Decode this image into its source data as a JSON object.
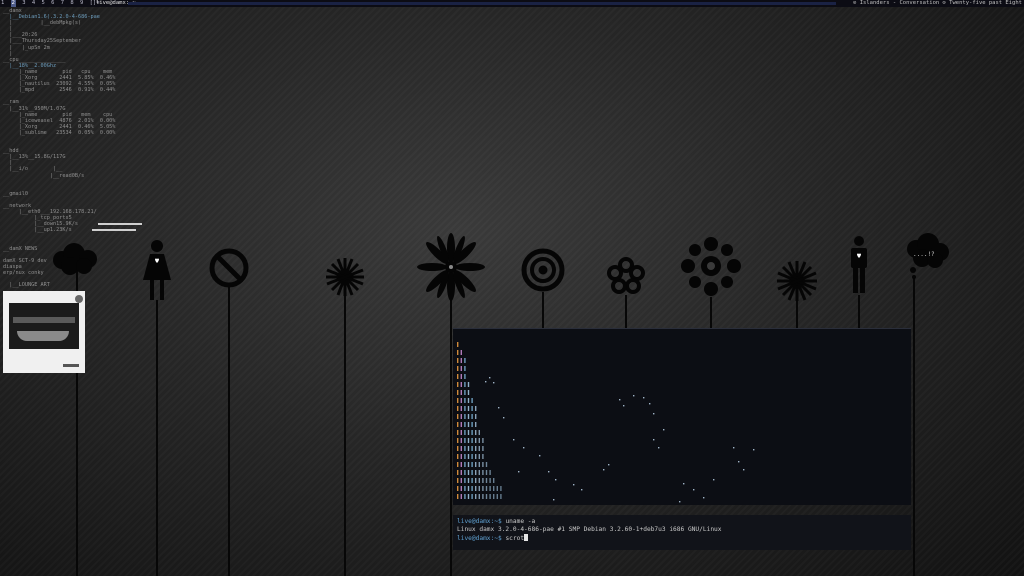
{
  "topbar": {
    "tags": [
      "1",
      "2",
      "3",
      "4",
      "5",
      "6",
      "7",
      "8",
      "9"
    ],
    "active_tag": "2",
    "layout_symbol": "[]=",
    "window_title": "live@damx: ~",
    "status_text": "⊙ Islanders - Conversation ⊙ Twenty-five past Eight"
  },
  "conky": {
    "lines": [
      "__damx",
      "  |__Debian1.6(.3.2.0-4-686-pae",
      "  |         |__debMpkg(s)",
      "  |",
      "  |___20:26",
      "  |___Thursday25September",
      "  |   |_upSn 2m",
      "  |",
      "__cpu_______________",
      "  |__18%__2.00Ghz",
      "     |_name        pid   cpu    mem",
      "     |_Xorg       2441  5.85%  0.46%",
      "     |_nautilus  23092  4.55%  0.05%",
      "     |_mpd        2546  0.91%  0.44%",
      "",
      "__ram",
      "  |__31%__950M/1.07G",
      "     |_name        pid   mem    cpu",
      "     |_iceweasel  4876  2.01%  0.00%",
      "     |_Xorg       2441  0.46%  5.05%",
      "     |_sublime   23534  0.05%  0.00%",
      "",
      "",
      "__hdd",
      "  |__13%__15.8G/117G",
      "  |",
      "  |__i/o        |__",
      "               |__read0B/s",
      "",
      "",
      "__gmail0",
      "",
      "__network",
      "     |__eth0___192.168.178.21/",
      "          |_tcp_ports5",
      "          |__down15.9K/s",
      "          |__up1.23K/s",
      "",
      "",
      "__damX NEWS",
      "",
      "damX SCT-9 dev",
      "diaspa",
      "erp/nux conky",
      "",
      "  |__LOUNGE ART"
    ]
  },
  "speech_bubble": "....!?",
  "terminal": {
    "prompt": "live@damx:~$",
    "command_1": "uname -a",
    "output_1": "Linux damx 3.2.0-4-686-pae #1 SMP Debian 3.2.60-1+deb7u3 i686 GNU/Linux",
    "command_2": "scrot"
  },
  "colors": {
    "accent_blue": "#6d9dbd",
    "tag_active_bg": "#4d5b8a",
    "terminal_bg": "#0c0e14"
  }
}
